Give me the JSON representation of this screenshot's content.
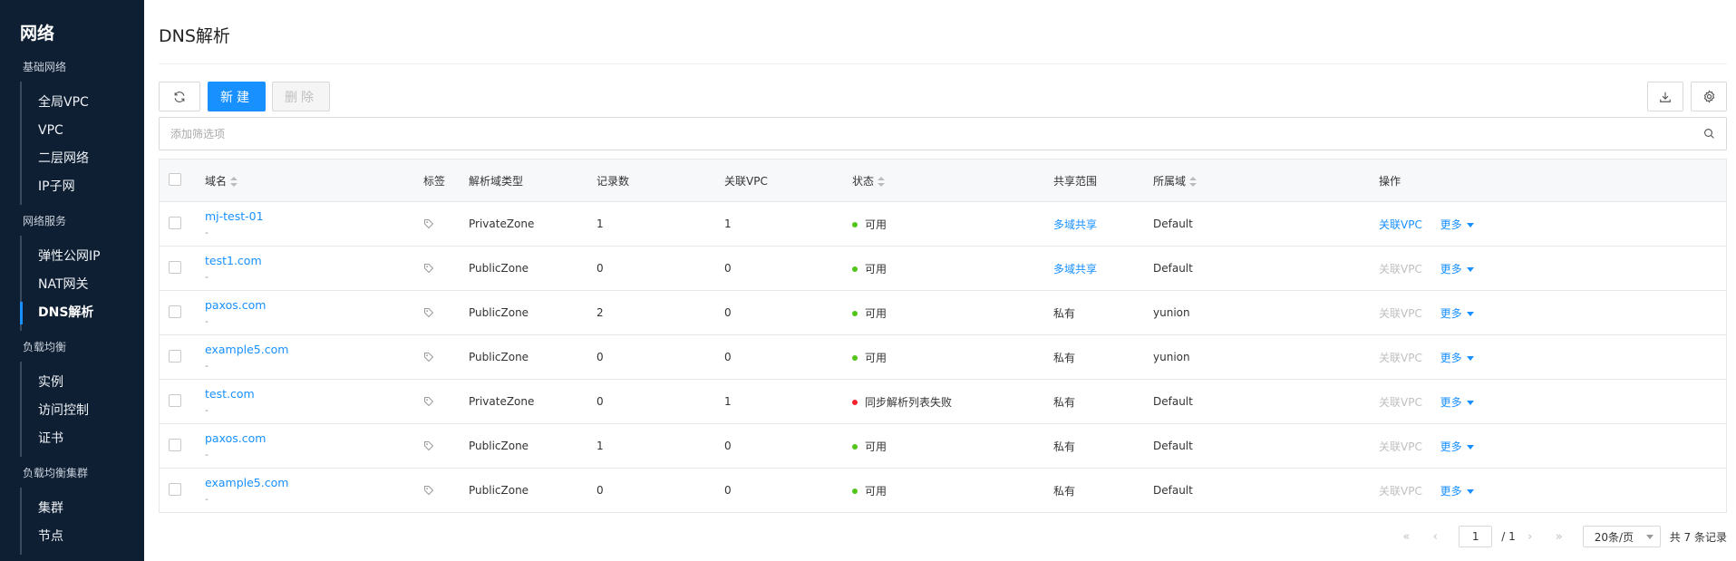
{
  "sidebar": {
    "title": "网络",
    "groups": [
      {
        "label": "基础网络",
        "items": [
          "全局VPC",
          "VPC",
          "二层网络",
          "IP子网"
        ]
      },
      {
        "label": "网络服务",
        "items": [
          "弹性公网IP",
          "NAT网关",
          "DNS解析"
        ]
      },
      {
        "label": "负载均衡",
        "items": [
          "实例",
          "访问控制",
          "证书"
        ]
      },
      {
        "label": "负载均衡集群",
        "items": [
          "集群",
          "节点"
        ]
      }
    ],
    "active_item": "DNS解析"
  },
  "page_title": "DNS解析",
  "toolbar": {
    "refresh_icon": "refresh-icon",
    "create_label": "新建",
    "delete_label": "删除",
    "download_icon": "download-icon",
    "settings_icon": "gear-icon"
  },
  "filter": {
    "placeholder": "添加筛选项",
    "icon": "search-icon"
  },
  "table": {
    "headers": {
      "name": "域名",
      "tags": "标签",
      "zone_type": "解析域类型",
      "records": "记录数",
      "vpc": "关联VPC",
      "status": "状态",
      "share": "共享范围",
      "domain": "所属域",
      "ops": "操作"
    },
    "rows": [
      {
        "name": "mj-test-01",
        "sub": "-",
        "zone_type": "PrivateZone",
        "records": "1",
        "vpc": "1",
        "status": "可用",
        "status_color": "#52c41a",
        "share": "多域共享",
        "share_link": true,
        "domain": "Default",
        "op_vpc": "关联VPC",
        "op_vpc_enabled": true,
        "op_more": "更多"
      },
      {
        "name": "test1.com",
        "sub": "-",
        "zone_type": "PublicZone",
        "records": "0",
        "vpc": "0",
        "status": "可用",
        "status_color": "#52c41a",
        "share": "多域共享",
        "share_link": true,
        "domain": "Default",
        "op_vpc": "关联VPC",
        "op_vpc_enabled": false,
        "op_more": "更多"
      },
      {
        "name": "paxos.com",
        "sub": "-",
        "zone_type": "PublicZone",
        "records": "2",
        "vpc": "0",
        "status": "可用",
        "status_color": "#52c41a",
        "share": "私有",
        "share_link": false,
        "domain": "yunion",
        "op_vpc": "关联VPC",
        "op_vpc_enabled": false,
        "op_more": "更多"
      },
      {
        "name": "example5.com",
        "sub": "-",
        "zone_type": "PublicZone",
        "records": "0",
        "vpc": "0",
        "status": "可用",
        "status_color": "#52c41a",
        "share": "私有",
        "share_link": false,
        "domain": "yunion",
        "op_vpc": "关联VPC",
        "op_vpc_enabled": false,
        "op_more": "更多"
      },
      {
        "name": "test.com",
        "sub": "-",
        "zone_type": "PrivateZone",
        "records": "0",
        "vpc": "1",
        "status": "同步解析列表失败",
        "status_color": "#f5222d",
        "share": "私有",
        "share_link": false,
        "domain": "Default",
        "op_vpc": "关联VPC",
        "op_vpc_enabled": false,
        "op_more": "更多"
      },
      {
        "name": "paxos.com",
        "sub": "-",
        "zone_type": "PublicZone",
        "records": "1",
        "vpc": "0",
        "status": "可用",
        "status_color": "#52c41a",
        "share": "私有",
        "share_link": false,
        "domain": "Default",
        "op_vpc": "关联VPC",
        "op_vpc_enabled": false,
        "op_more": "更多"
      },
      {
        "name": "example5.com",
        "sub": "-",
        "zone_type": "PublicZone",
        "records": "0",
        "vpc": "0",
        "status": "可用",
        "status_color": "#52c41a",
        "share": "私有",
        "share_link": false,
        "domain": "Default",
        "op_vpc": "关联VPC",
        "op_vpc_enabled": false,
        "op_more": "更多"
      }
    ]
  },
  "pagination": {
    "current_page": "1",
    "total_pages": "/ 1",
    "page_size": "20条/页",
    "total_text": "共 7 条记录"
  },
  "colors": {
    "accent": "#1890ff",
    "sidebar_bg": "#0f1f33",
    "success": "#52c41a",
    "error": "#f5222d"
  }
}
